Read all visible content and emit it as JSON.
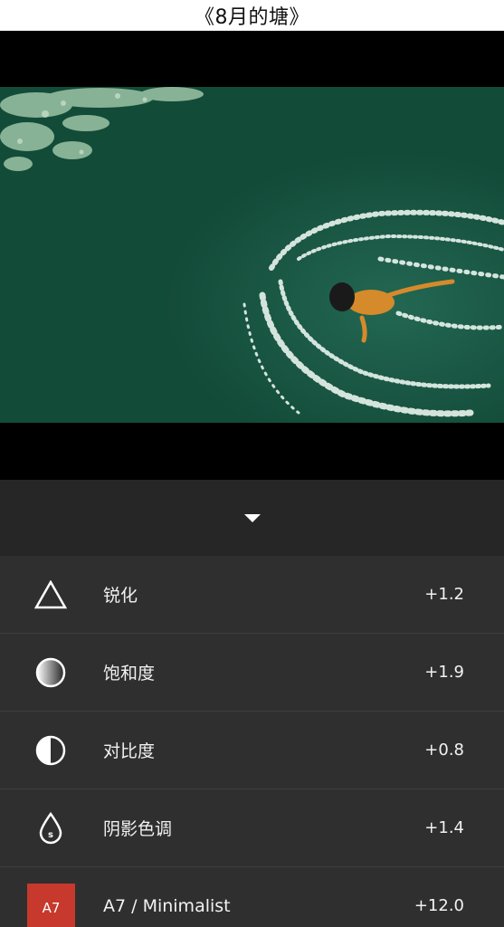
{
  "header": {
    "title": "《8月的塘》"
  },
  "adjustments": [
    {
      "icon": "sharpen-triangle-icon",
      "label": "锐化",
      "value": "+1.2"
    },
    {
      "icon": "saturation-gradient-circle-icon",
      "label": "饱和度",
      "value": "+1.9"
    },
    {
      "icon": "contrast-half-circle-icon",
      "label": "对比度",
      "value": "+0.8"
    },
    {
      "icon": "shadow-tint-drop-icon",
      "label": "阴影色调",
      "value": "+1.4"
    }
  ],
  "preset": {
    "thumb_label": "A7",
    "label": "A7 / Minimalist",
    "value": "+12.0"
  },
  "colors": {
    "water": "#164f3c",
    "panel": "#2f2f2f",
    "preset_red": "#c6392c"
  }
}
